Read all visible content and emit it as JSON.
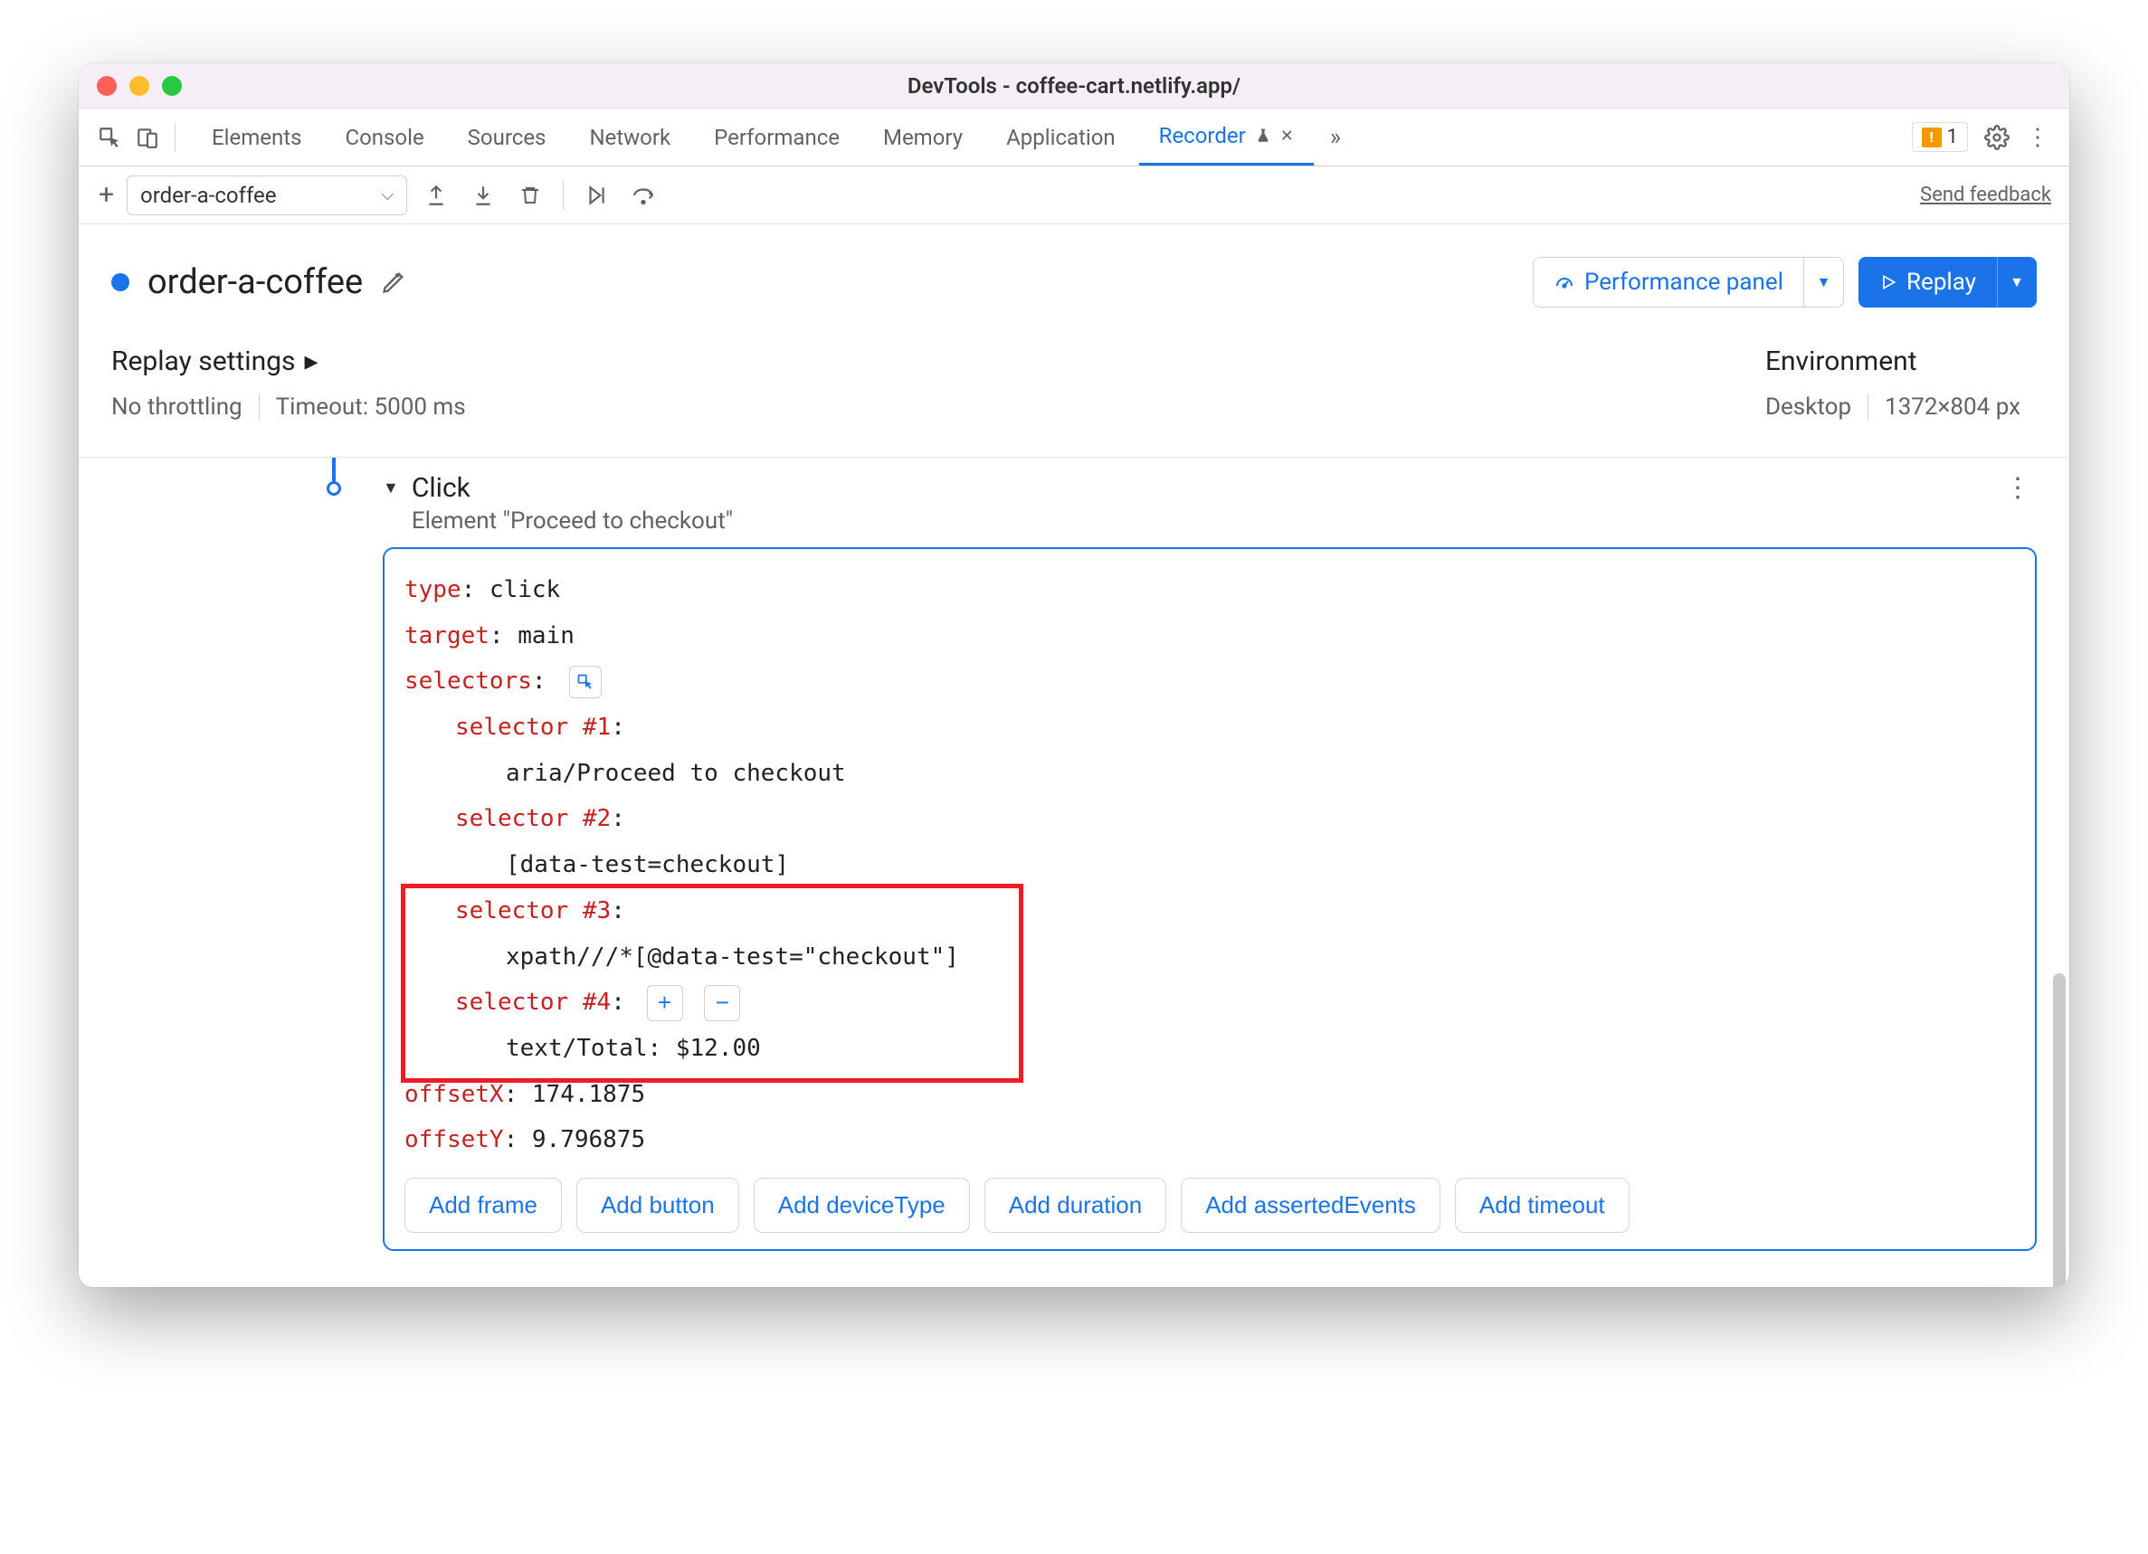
{
  "window": {
    "title": "DevTools - coffee-cart.netlify.app/"
  },
  "tabs": {
    "items": [
      "Elements",
      "Console",
      "Sources",
      "Network",
      "Performance",
      "Memory",
      "Application",
      "Recorder"
    ],
    "active": "Recorder",
    "warn_count": "1"
  },
  "toolbar": {
    "recording_name": "order-a-coffee",
    "feedback": "Send feedback"
  },
  "header": {
    "title": "order-a-coffee",
    "perf_btn": "Performance panel",
    "replay_btn": "Replay"
  },
  "settings": {
    "replay_heading": "Replay settings",
    "throttling": "No throttling",
    "timeout": "Timeout: 5000 ms",
    "env_heading": "Environment",
    "device": "Desktop",
    "dims": "1372×804 px"
  },
  "step": {
    "title": "Click",
    "subtitle": "Element \"Proceed to checkout\"",
    "type_label": "type",
    "type_value": "click",
    "target_label": "target",
    "target_value": "main",
    "selectors_label": "selectors",
    "sel1_label": "selector #1",
    "sel1_value": "aria/Proceed to checkout",
    "sel2_label": "selector #2",
    "sel2_value": "[data-test=checkout]",
    "sel3_label": "selector #3",
    "sel3_value": "xpath///*[@data-test=\"checkout\"]",
    "sel4_label": "selector #4",
    "sel4_value": "text/Total: $12.00",
    "offsetx_label": "offsetX",
    "offsetx_value": "174.1875",
    "offsety_label": "offsetY",
    "offsety_value": "9.796875",
    "add_buttons": [
      "Add frame",
      "Add button",
      "Add deviceType",
      "Add duration",
      "Add assertedEvents",
      "Add timeout"
    ]
  }
}
